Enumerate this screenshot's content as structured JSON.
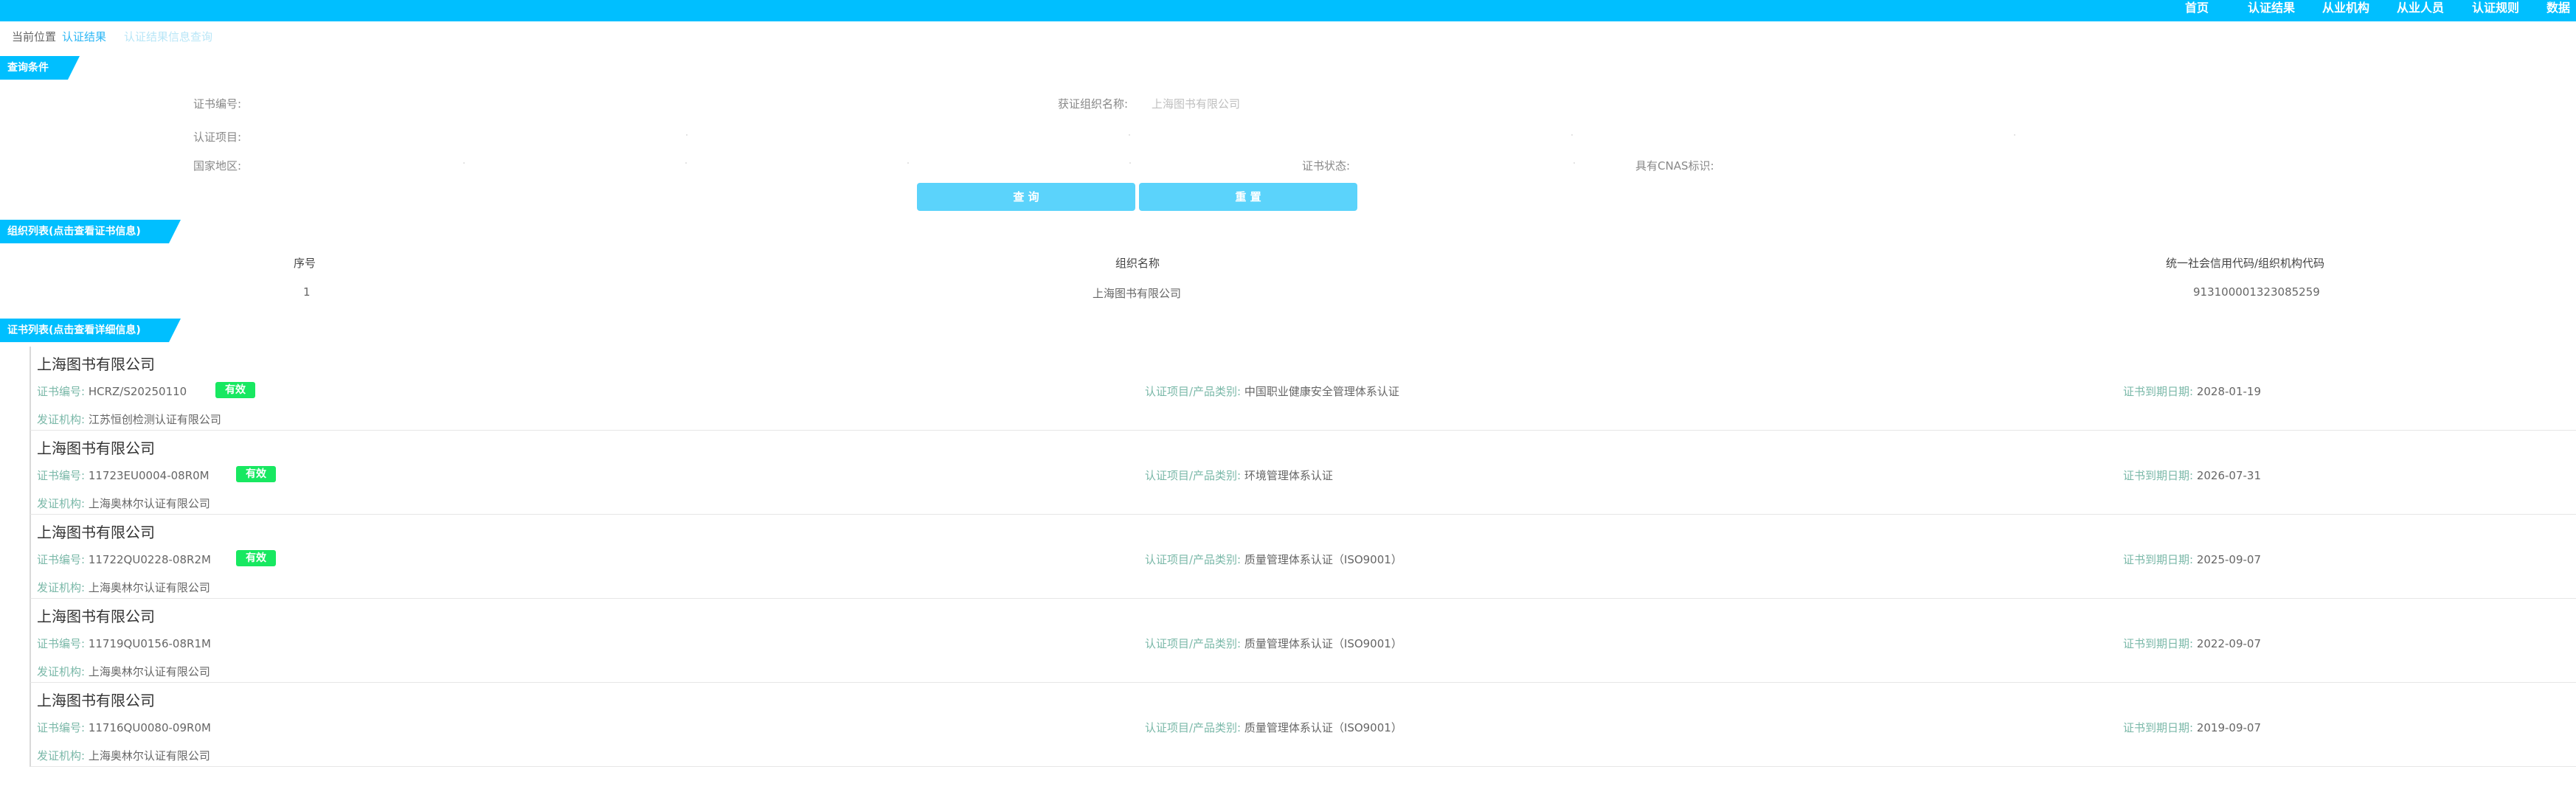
{
  "nav": {
    "items": [
      "首页",
      "认证结果",
      "从业机构",
      "从业人员",
      "认证规则",
      "数据"
    ]
  },
  "breadcrumb": {
    "items": [
      "当前位置",
      "认证结果",
      "认证结果信息查询"
    ]
  },
  "sections": {
    "query": "查询条件",
    "org_list": "组织列表(点击查看证书信息)",
    "cert_list": "证书列表(点击查看详细信息)"
  },
  "query_form": {
    "cert_no_label": "证书编号:",
    "cert_no_value": "",
    "org_name_label": "获证组织名称:",
    "org_name_value": "上海图书有限公司",
    "project_label": "认证项目:",
    "region_label": "国家地区:",
    "status_label": "证书状态:",
    "cnas_label": "具有CNAS标识:"
  },
  "buttons": {
    "query": "查 询",
    "reset": "重 置"
  },
  "org_table": {
    "headers": [
      "序号",
      "组织名称",
      "统一社会信用代码/组织机构代码"
    ],
    "rows": [
      [
        "1",
        "上海图书有限公司",
        "913100001323085259"
      ]
    ]
  },
  "cert_labels": {
    "cert_no": "证书编号:",
    "issuer": "发证机构:",
    "project": "认证项目/产品类别:",
    "expiry": "证书到期日期:"
  },
  "certs": [
    {
      "org": "上海图书有限公司",
      "cert_no": "HCRZ/S20250110",
      "status": "有效",
      "issuer": "江苏恒创检测认证有限公司",
      "project": "中国职业健康安全管理体系认证",
      "expiry": "2028-01-19"
    },
    {
      "org": "上海图书有限公司",
      "cert_no": "11723EU0004-08R0M",
      "status": "有效",
      "issuer": "上海奥林尔认证有限公司",
      "project": "环境管理体系认证",
      "expiry": "2026-07-31"
    },
    {
      "org": "上海图书有限公司",
      "cert_no": "11722QU0228-08R2M",
      "status": "有效",
      "issuer": "上海奥林尔认证有限公司",
      "project": "质量管理体系认证（ISO9001）",
      "expiry": "2025-09-07"
    },
    {
      "org": "上海图书有限公司",
      "cert_no": "11719QU0156-08R1M",
      "status": "",
      "issuer": "上海奥林尔认证有限公司",
      "project": "质量管理体系认证（ISO9001）",
      "expiry": "2022-09-07"
    },
    {
      "org": "上海图书有限公司",
      "cert_no": "11716QU0080-09R0M",
      "status": "",
      "issuer": "上海奥林尔认证有限公司",
      "project": "质量管理体系认证（ISO9001）",
      "expiry": "2019-09-07"
    }
  ],
  "colors": {
    "primary": "#00bfff",
    "button": "#5bd3fb",
    "valid_badge": "#18e861"
  }
}
